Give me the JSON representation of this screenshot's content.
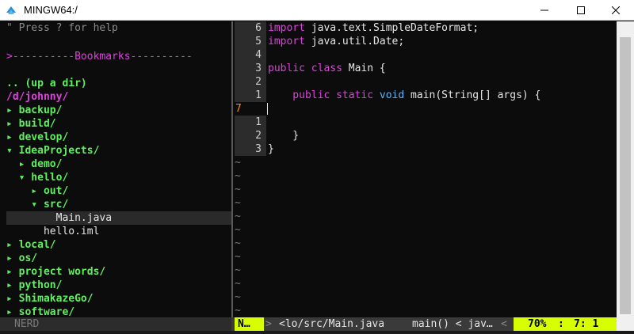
{
  "window": {
    "title": "MINGW64:/",
    "controls": [
      "minimize-icon",
      "maximize-icon",
      "close-icon"
    ]
  },
  "nerdtree": {
    "help": "\" Press ? for help",
    "bookmarks": ">----------Bookmarks----------",
    "up_dir": ".. (up a dir)",
    "root": "/d/johnny/",
    "items": [
      {
        "text": "▸ backup/"
      },
      {
        "text": "▸ build/"
      },
      {
        "text": "▸ develop/"
      },
      {
        "text": "▾ IdeaProjects/"
      },
      {
        "text": "  ▸ demo/"
      },
      {
        "text": "  ▾ hello/"
      },
      {
        "text": "    ▸ out/"
      },
      {
        "text": "    ▾ src/"
      },
      {
        "text": "        Main.java"
      },
      {
        "text": "      hello.iml"
      },
      {
        "text": "▸ local/"
      },
      {
        "text": "▸ os/"
      },
      {
        "text": "▸ project words/"
      },
      {
        "text": "▸ python/"
      },
      {
        "text": "▸ ShimakazeGo/"
      },
      {
        "text": "▸ software/"
      }
    ]
  },
  "editor": {
    "gutter": [
      "6",
      "5",
      "4",
      "3",
      "2",
      "1",
      "7",
      "1",
      "2",
      "3"
    ],
    "lines": {
      "l1_a": "import",
      "l1_b": " java.text.SimpleDateFormat;",
      "l2_a": "import",
      "l2_b": " java.util.Date;",
      "l4_a": "public class",
      "l4_b": " Main {",
      "l6_a": "    public static",
      "l6_b": " void",
      "l6_c": " main(String[] args) {",
      "l9": "    }",
      "l10": "}"
    },
    "tilde": "~"
  },
  "statusbar": {
    "nerd": "NERD",
    "mode": "N…",
    "sep1": ">",
    "file": "<lo/src/Main.java",
    "func": "main() < jav…",
    "sep2": "<",
    "percent": "70%",
    "colon": ":",
    "position": "7:  1"
  },
  "colors": {
    "accent": "#d7ff00",
    "keyword": "#e040e0",
    "type_keyword": "#5ab4ff",
    "tree_dir": "#5ff05f",
    "current_line_number": "#ff8c1a"
  }
}
